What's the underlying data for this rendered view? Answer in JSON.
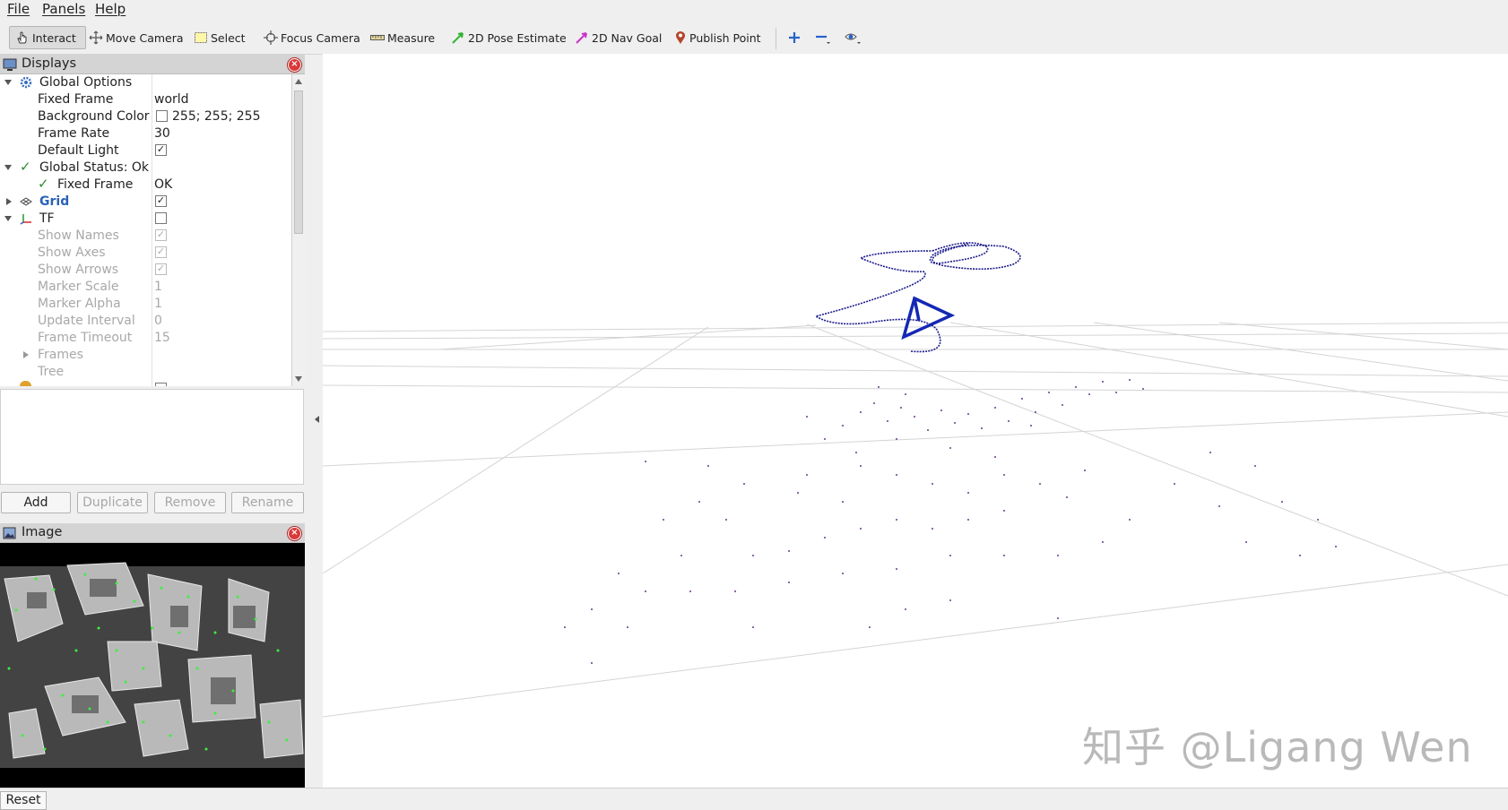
{
  "menu": {
    "file": "File",
    "panels": "Panels",
    "help": "Help"
  },
  "toolbar": {
    "interact": "Interact",
    "move_camera": "Move Camera",
    "select": "Select",
    "focus_camera": "Focus Camera",
    "measure": "Measure",
    "pose_estimate": "2D Pose Estimate",
    "nav_goal": "2D Nav Goal",
    "publish_point": "Publish Point",
    "colors": {
      "pose": "#2fb52f",
      "goal": "#cc33cc",
      "point": "#b3472b",
      "plus": "#2563c9"
    }
  },
  "displays": {
    "title": "Displays",
    "rows": {
      "global_options": "Global Options",
      "fixed_frame_label": "Fixed Frame",
      "fixed_frame_value": "world",
      "bg_color_label": "Background Color",
      "bg_color_value": "255; 255; 255",
      "frame_rate_label": "Frame Rate",
      "frame_rate_value": "30",
      "default_light_label": "Default Light",
      "global_status": "Global Status: Ok",
      "status_fixed_frame": "Fixed Frame",
      "status_fixed_frame_value": "OK",
      "grid": "Grid",
      "tf": "TF",
      "show_names": "Show Names",
      "show_axes": "Show Axes",
      "show_arrows": "Show Arrows",
      "marker_scale": "Marker Scale",
      "marker_scale_value": "1",
      "marker_alpha": "Marker Alpha",
      "marker_alpha_value": "1",
      "update_interval": "Update Interval",
      "update_interval_value": "0",
      "frame_timeout": "Frame Timeout",
      "frame_timeout_value": "15",
      "frames": "Frames",
      "tree": "Tree"
    },
    "checks": {
      "default_light": true,
      "grid": true,
      "tf": false,
      "show_names": true,
      "show_axes": true,
      "show_arrows": true
    }
  },
  "buttons": {
    "add": "Add",
    "duplicate": "Duplicate",
    "remove": "Remove",
    "rename": "Rename"
  },
  "image_panel": {
    "title": "Image"
  },
  "viewport": {
    "watermark": "知乎 @Ligang Wen",
    "trajectory_color": "#1a1a8a",
    "camera_color": "#1428b4"
  },
  "status": {
    "reset": "Reset"
  }
}
